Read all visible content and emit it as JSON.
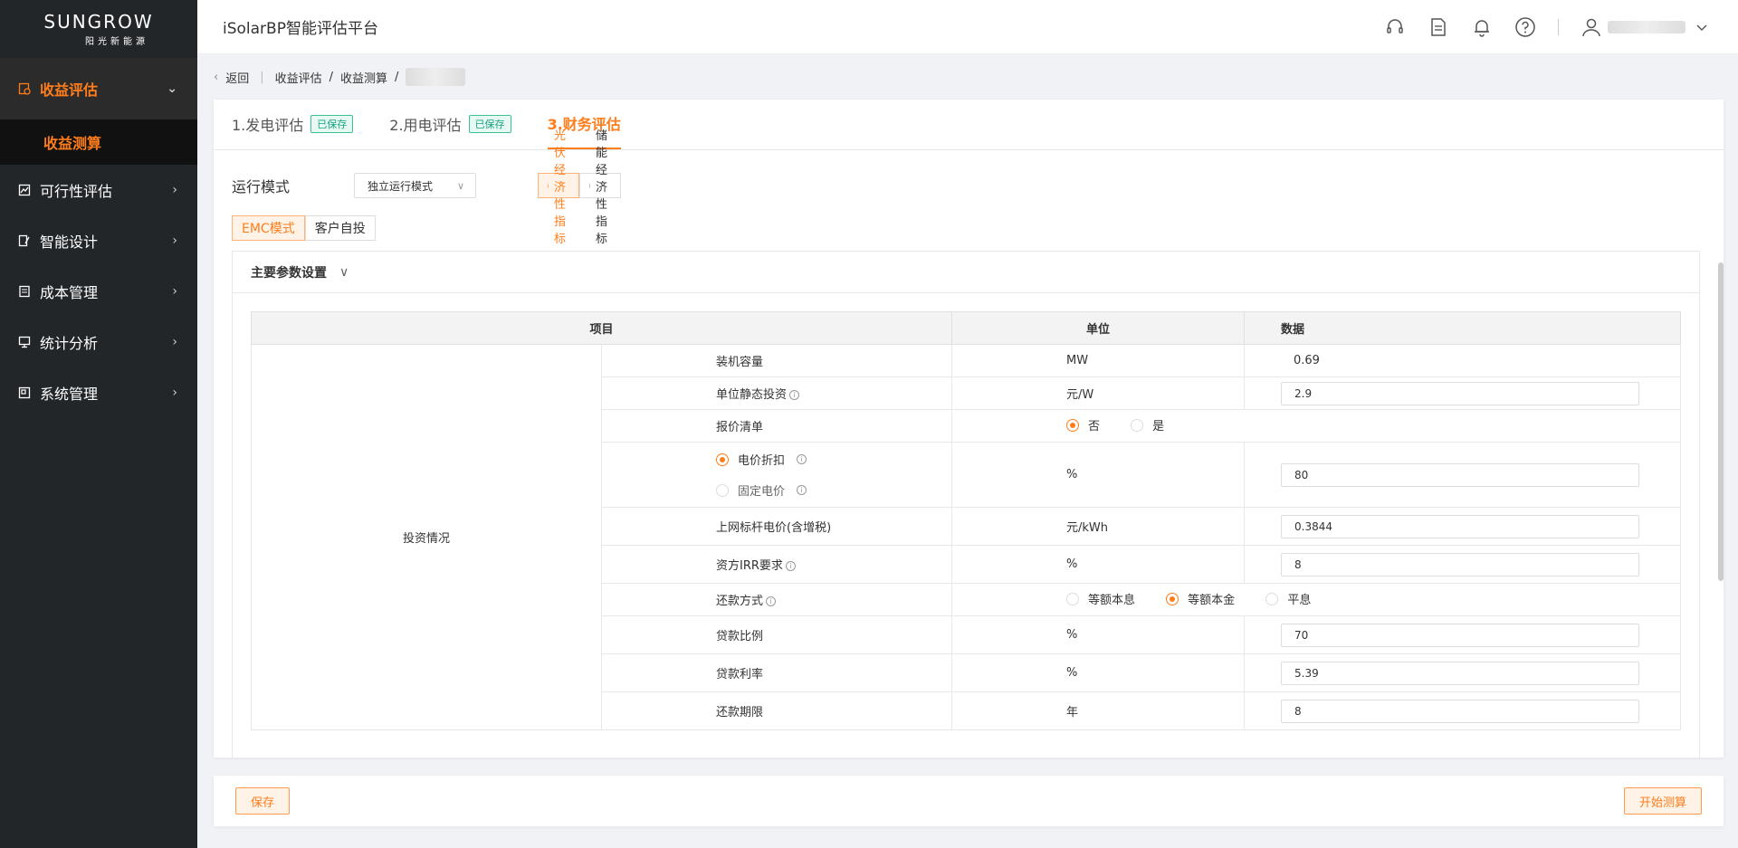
{
  "brand": {
    "name": "SUNGROW",
    "sub": "阳光新能源"
  },
  "sidebar": {
    "items": [
      {
        "label": "收益评估",
        "icon": "revenue-icon",
        "chevron": "⌄"
      },
      {
        "label": "可行性评估",
        "icon": "chart-icon",
        "chevron": "›"
      },
      {
        "label": "智能设计",
        "icon": "design-icon",
        "chevron": "›"
      },
      {
        "label": "成本管理",
        "icon": "cost-icon",
        "chevron": "›"
      },
      {
        "label": "统计分析",
        "icon": "stats-icon",
        "chevron": "›"
      },
      {
        "label": "系统管理",
        "icon": "settings-icon",
        "chevron": "›"
      }
    ],
    "sub_item": "收益测算"
  },
  "header": {
    "title": "iSolarBP智能评估平台"
  },
  "breadcrumb": {
    "back": "返回",
    "level1": "收益评估",
    "level2": "收益测算",
    "sep": "/"
  },
  "steps": [
    {
      "label": "1.发电评估",
      "badge": "已保存"
    },
    {
      "label": "2.用电评估",
      "badge": "已保存"
    },
    {
      "label": "3.财务评估"
    }
  ],
  "mode": {
    "label": "运行模式",
    "value": "独立运行模式"
  },
  "indicators": {
    "pv": "光伏经济性指标",
    "storage": "储能经济性指标"
  },
  "invest_modes": {
    "emc": "EMC模式",
    "self": "客户自投"
  },
  "panel": {
    "title": "主要参数设置"
  },
  "table": {
    "headers": {
      "item": "项目",
      "unit": "单位",
      "data": "数据"
    },
    "section": "投资情况",
    "rows": {
      "capacity": {
        "label": "装机容量",
        "unit": "MW",
        "value": "0.69"
      },
      "unit_invest": {
        "label": "单位静态投资",
        "unit": "元/W",
        "value": "2.9"
      },
      "quote": {
        "label": "报价清单",
        "opt_no": "否",
        "opt_yes": "是"
      },
      "price": {
        "opt1": "电价折扣",
        "opt2": "固定电价",
        "unit": "%",
        "value": "80"
      },
      "grid_price": {
        "label": "上网标杆电价(含增税)",
        "unit": "元/kWh",
        "value": "0.3844"
      },
      "irr": {
        "label": "资方IRR要求",
        "unit": "%",
        "value": "8"
      },
      "repay": {
        "label": "还款方式",
        "opt1": "等额本息",
        "opt2": "等额本金",
        "opt3": "平息"
      },
      "loan_ratio": {
        "label": "贷款比例",
        "unit": "%",
        "value": "70"
      },
      "loan_rate": {
        "label": "贷款利率",
        "unit": "%",
        "value": "5.39"
      },
      "loan_term": {
        "label": "还款期限",
        "unit": "年",
        "value": "8"
      }
    }
  },
  "footer": {
    "save": "保存",
    "start": "开始测算"
  },
  "colors": {
    "accent": "#ff7d1a",
    "sidebar": "#232629",
    "saved": "#14a37f"
  }
}
